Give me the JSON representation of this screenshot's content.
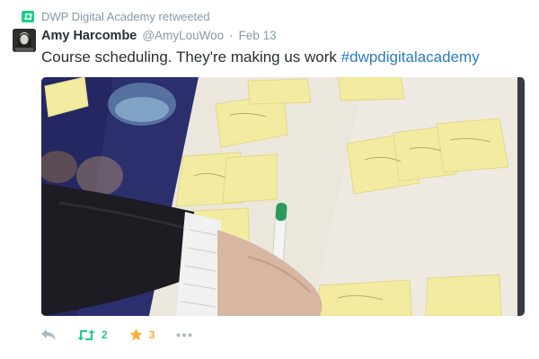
{
  "context": {
    "retweeter_text": "DWP Digital Academy retweeted",
    "icon": "retweet-icon",
    "icon_color": "#19cf86"
  },
  "tweet": {
    "author_name": "Amy Harcombe",
    "author_handle": "@AmyLouWoo",
    "separator": "·",
    "timestamp": "Feb 13",
    "text": "Course scheduling. They're making us work ",
    "hashtag": "#dwpdigitalacademy",
    "hashtag_color": "#2b7bb9"
  },
  "actions": {
    "reply_icon": "reply-icon",
    "retweet_icon": "retweet-icon",
    "retweet_count": "2",
    "retweet_color": "#19cf86",
    "favorite_icon": "star-icon",
    "favorite_count": "3",
    "favorite_color": "#ffac33",
    "more_icon": "more-icon"
  }
}
